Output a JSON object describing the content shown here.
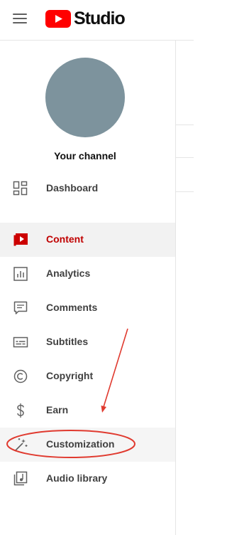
{
  "app": {
    "logo_text": "Studio"
  },
  "channel": {
    "label": "Your channel"
  },
  "nav": {
    "items": [
      {
        "label": "Dashboard",
        "icon": "dashboard-icon"
      },
      {
        "label": "Content",
        "icon": "content-icon",
        "active": true
      },
      {
        "label": "Analytics",
        "icon": "analytics-icon"
      },
      {
        "label": "Comments",
        "icon": "comments-icon"
      },
      {
        "label": "Subtitles",
        "icon": "subtitles-icon"
      },
      {
        "label": "Copyright",
        "icon": "copyright-icon"
      },
      {
        "label": "Earn",
        "icon": "earn-icon"
      },
      {
        "label": "Customization",
        "icon": "magic-wand-icon",
        "highlighted": true
      },
      {
        "label": "Audio library",
        "icon": "audio-library-icon"
      }
    ]
  },
  "colors": {
    "brand_red": "#ff0000",
    "active_red": "#c00000",
    "annotation_red": "#e03a2f",
    "avatar": "#7d939d"
  }
}
